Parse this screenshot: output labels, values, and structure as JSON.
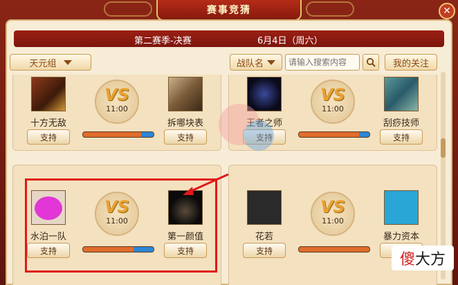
{
  "header": {
    "title": "赛事竞猜",
    "close_icon": "close-icon"
  },
  "match_bar": {
    "season": "第二赛季-决赛",
    "date": "6月4日（周六）"
  },
  "controls": {
    "group_dropdown": "天元组",
    "team_dropdown": "战队名",
    "search_placeholder": "请输入搜索内容",
    "follow_button": "我的关注"
  },
  "matches": [
    {
      "team_a": "十方无敌",
      "team_b": "拆哪块表",
      "time": "11:00",
      "vs": "VS",
      "support_a": "支持",
      "support_b": "支持",
      "bet_share_a": 0.82
    },
    {
      "team_a": "王者之师",
      "team_b": "刮痧技师",
      "time": "11:00",
      "vs": "VS",
      "support_a": "支持",
      "support_b": "支持",
      "bet_share_a": 0.85
    },
    {
      "team_a": "水泊一队",
      "team_b": "第一颜值",
      "time": "11:00",
      "vs": "VS",
      "support_a": "支持",
      "support_b": "支持",
      "bet_share_a": 0.72
    },
    {
      "team_a": "花若",
      "team_b": "暴力资本",
      "time": "11:00",
      "vs": "VS",
      "support_a": "支持",
      "support_b": "支持",
      "bet_share_a": 1.0
    }
  ],
  "site_badge": {
    "left": "傻",
    "right": "大方"
  },
  "colors": {
    "title_red": "#9b1f14",
    "bar_orange": "#e06c2d",
    "bar_blue": "#2c86d6",
    "annotation": "#e01818"
  }
}
